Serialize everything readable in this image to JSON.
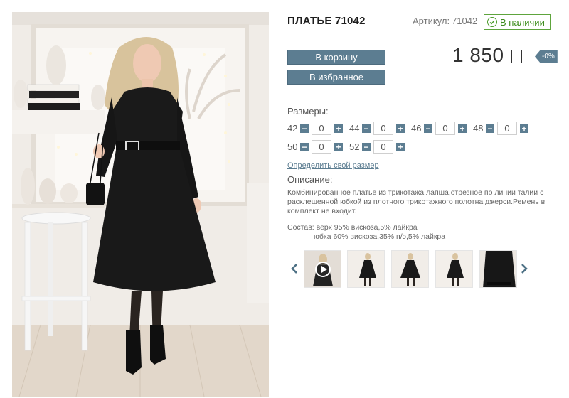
{
  "product": {
    "title": "ПЛАТЬЕ 71042",
    "sku_label": "Артикул:",
    "sku_value": "71042",
    "stock_label": "В наличии",
    "price": "1 850",
    "currency_icon": "ruble-sign-icon",
    "discount": "-0%"
  },
  "buttons": {
    "cart": "В корзину",
    "favorites": "В избранное"
  },
  "sizes": {
    "label": "Размеры:",
    "items": [
      {
        "size": "42",
        "qty": "0"
      },
      {
        "size": "44",
        "qty": "0"
      },
      {
        "size": "46",
        "qty": "0"
      },
      {
        "size": "48",
        "qty": "0"
      },
      {
        "size": "50",
        "qty": "0"
      },
      {
        "size": "52",
        "qty": "0"
      }
    ],
    "find_size_link": "Определить свой размер"
  },
  "description": {
    "label": "Описание:",
    "text": "Комбинированное платье из трикотажа лапша,отрезное по линии талии с расклешенной юбкой из плотного трикотажного полотна джерси.Ремень в комплект не входит."
  },
  "composition": {
    "line1": "Состав: верх 95% вискоза,5% лайкра",
    "line2": "юбка 60% вискоза,35% п/э,5% лайкра"
  },
  "gallery": {
    "prev_icon": "chevron-left-icon",
    "next_icon": "chevron-right-icon",
    "video_icon": "play-icon",
    "thumbnail_count": 5
  },
  "colors": {
    "accent": "#5c7d91",
    "stock_green": "#3f8d1f",
    "dress": "#161616"
  }
}
